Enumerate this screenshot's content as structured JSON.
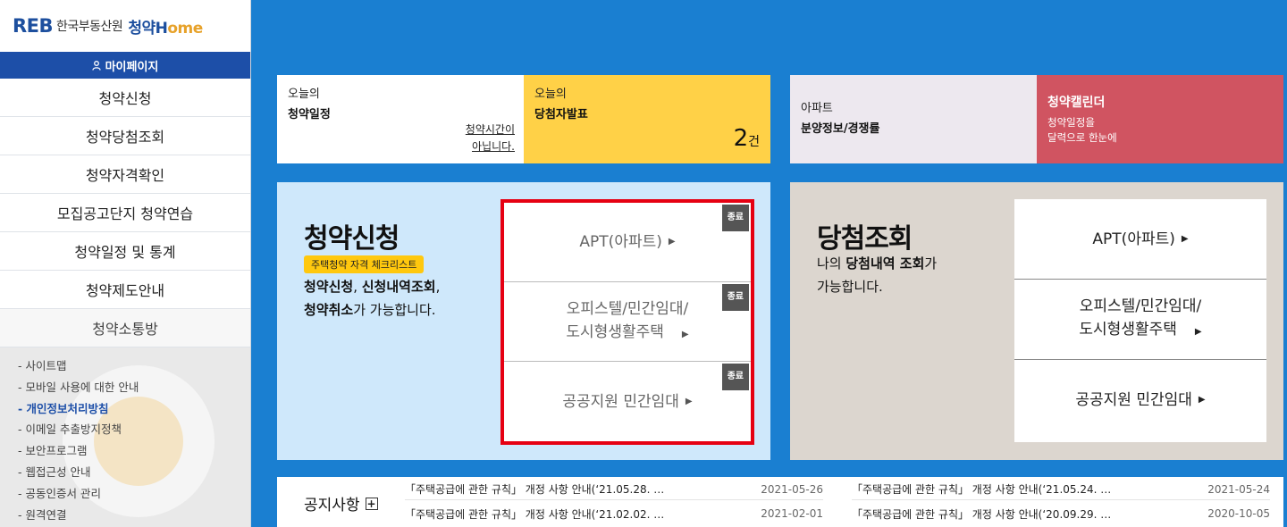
{
  "logo": {
    "reb": "REB",
    "org": "한국부동산원",
    "app_ko": "청약",
    "app_h": "H",
    "app_rest": "ome"
  },
  "mypage": {
    "label": "마이페이지"
  },
  "menu": [
    "청약신청",
    "청약당첨조회",
    "청약자격확인",
    "모집공고단지 청약연습",
    "청약일정 및 통계",
    "청약제도안내",
    "청약소통방"
  ],
  "links": [
    "- 사이트맵",
    "- 모바일 사용에 대한 안내",
    "- 개인정보처리방침",
    "- 이메일 추출방지정책",
    "- 보안프로그램",
    "- 웹접근성 안내",
    "- 공동인증서 관리",
    "- 원격연결"
  ],
  "cards": {
    "today_schedule": {
      "line1": "오늘의",
      "line2": "청약일정",
      "note1": "청약시간이",
      "note2": "아닙니다."
    },
    "today_winners": {
      "line1": "오늘의",
      "line2": "당첨자발표",
      "count": "2",
      "unit": "건"
    },
    "apt_info": {
      "line1": "아파트",
      "line2": "분양정보/경쟁률"
    },
    "calendar": {
      "line1": "청약캘린더",
      "line2": "청약일정을",
      "line3": "달력으로 한눈에"
    }
  },
  "apply": {
    "title": "청약신청",
    "badge": "주택청약 자격 체크리스트",
    "desc_b1": "청약신청",
    "desc_t1": ", ",
    "desc_b2": "신청내역조회",
    "desc_t2": ",",
    "desc_b3": "청약취소",
    "desc_t3": "가 가능합니다.",
    "items": [
      {
        "line1": "APT(아파트)",
        "line2": "",
        "badge": "종료"
      },
      {
        "line1": "오피스텔/민간임대/",
        "line2": "도시형생활주택",
        "badge": "종료"
      },
      {
        "line1": "공공지원 민간임대",
        "line2": "",
        "badge": "종료"
      }
    ]
  },
  "winner": {
    "title": "당첨조회",
    "desc_t1": "나의 ",
    "desc_b1": "당첨내역 조회",
    "desc_t2": "가",
    "desc_t3": "가능합니다.",
    "items": [
      {
        "line1": "APT(아파트)",
        "line2": ""
      },
      {
        "line1": "오피스텔/민간임대/",
        "line2": "도시형생활주택"
      },
      {
        "line1": "공공지원 민간임대",
        "line2": ""
      }
    ]
  },
  "notice": {
    "title": "공지사항",
    "plus": "+",
    "rows": [
      {
        "text": "「주택공급에 관한 규칙」 개정 사항 안내(‘21.05.28. …",
        "date": "2021-05-26"
      },
      {
        "text": "「주택공급에 관한 규칙」 개정 사항 안내(‘21.05.24. …",
        "date": "2021-05-24"
      },
      {
        "text": "「주택공급에 관한 규칙」 개정 사항 안내(‘21.02.02. …",
        "date": "2021-02-01"
      },
      {
        "text": "「주택공급에 관한 규칙」 개정 사항 안내(‘20.09.29. …",
        "date": "2020-10-05"
      }
    ]
  },
  "icons": {
    "mypage": "person-icon",
    "arrow": "triangle-right-icon"
  }
}
